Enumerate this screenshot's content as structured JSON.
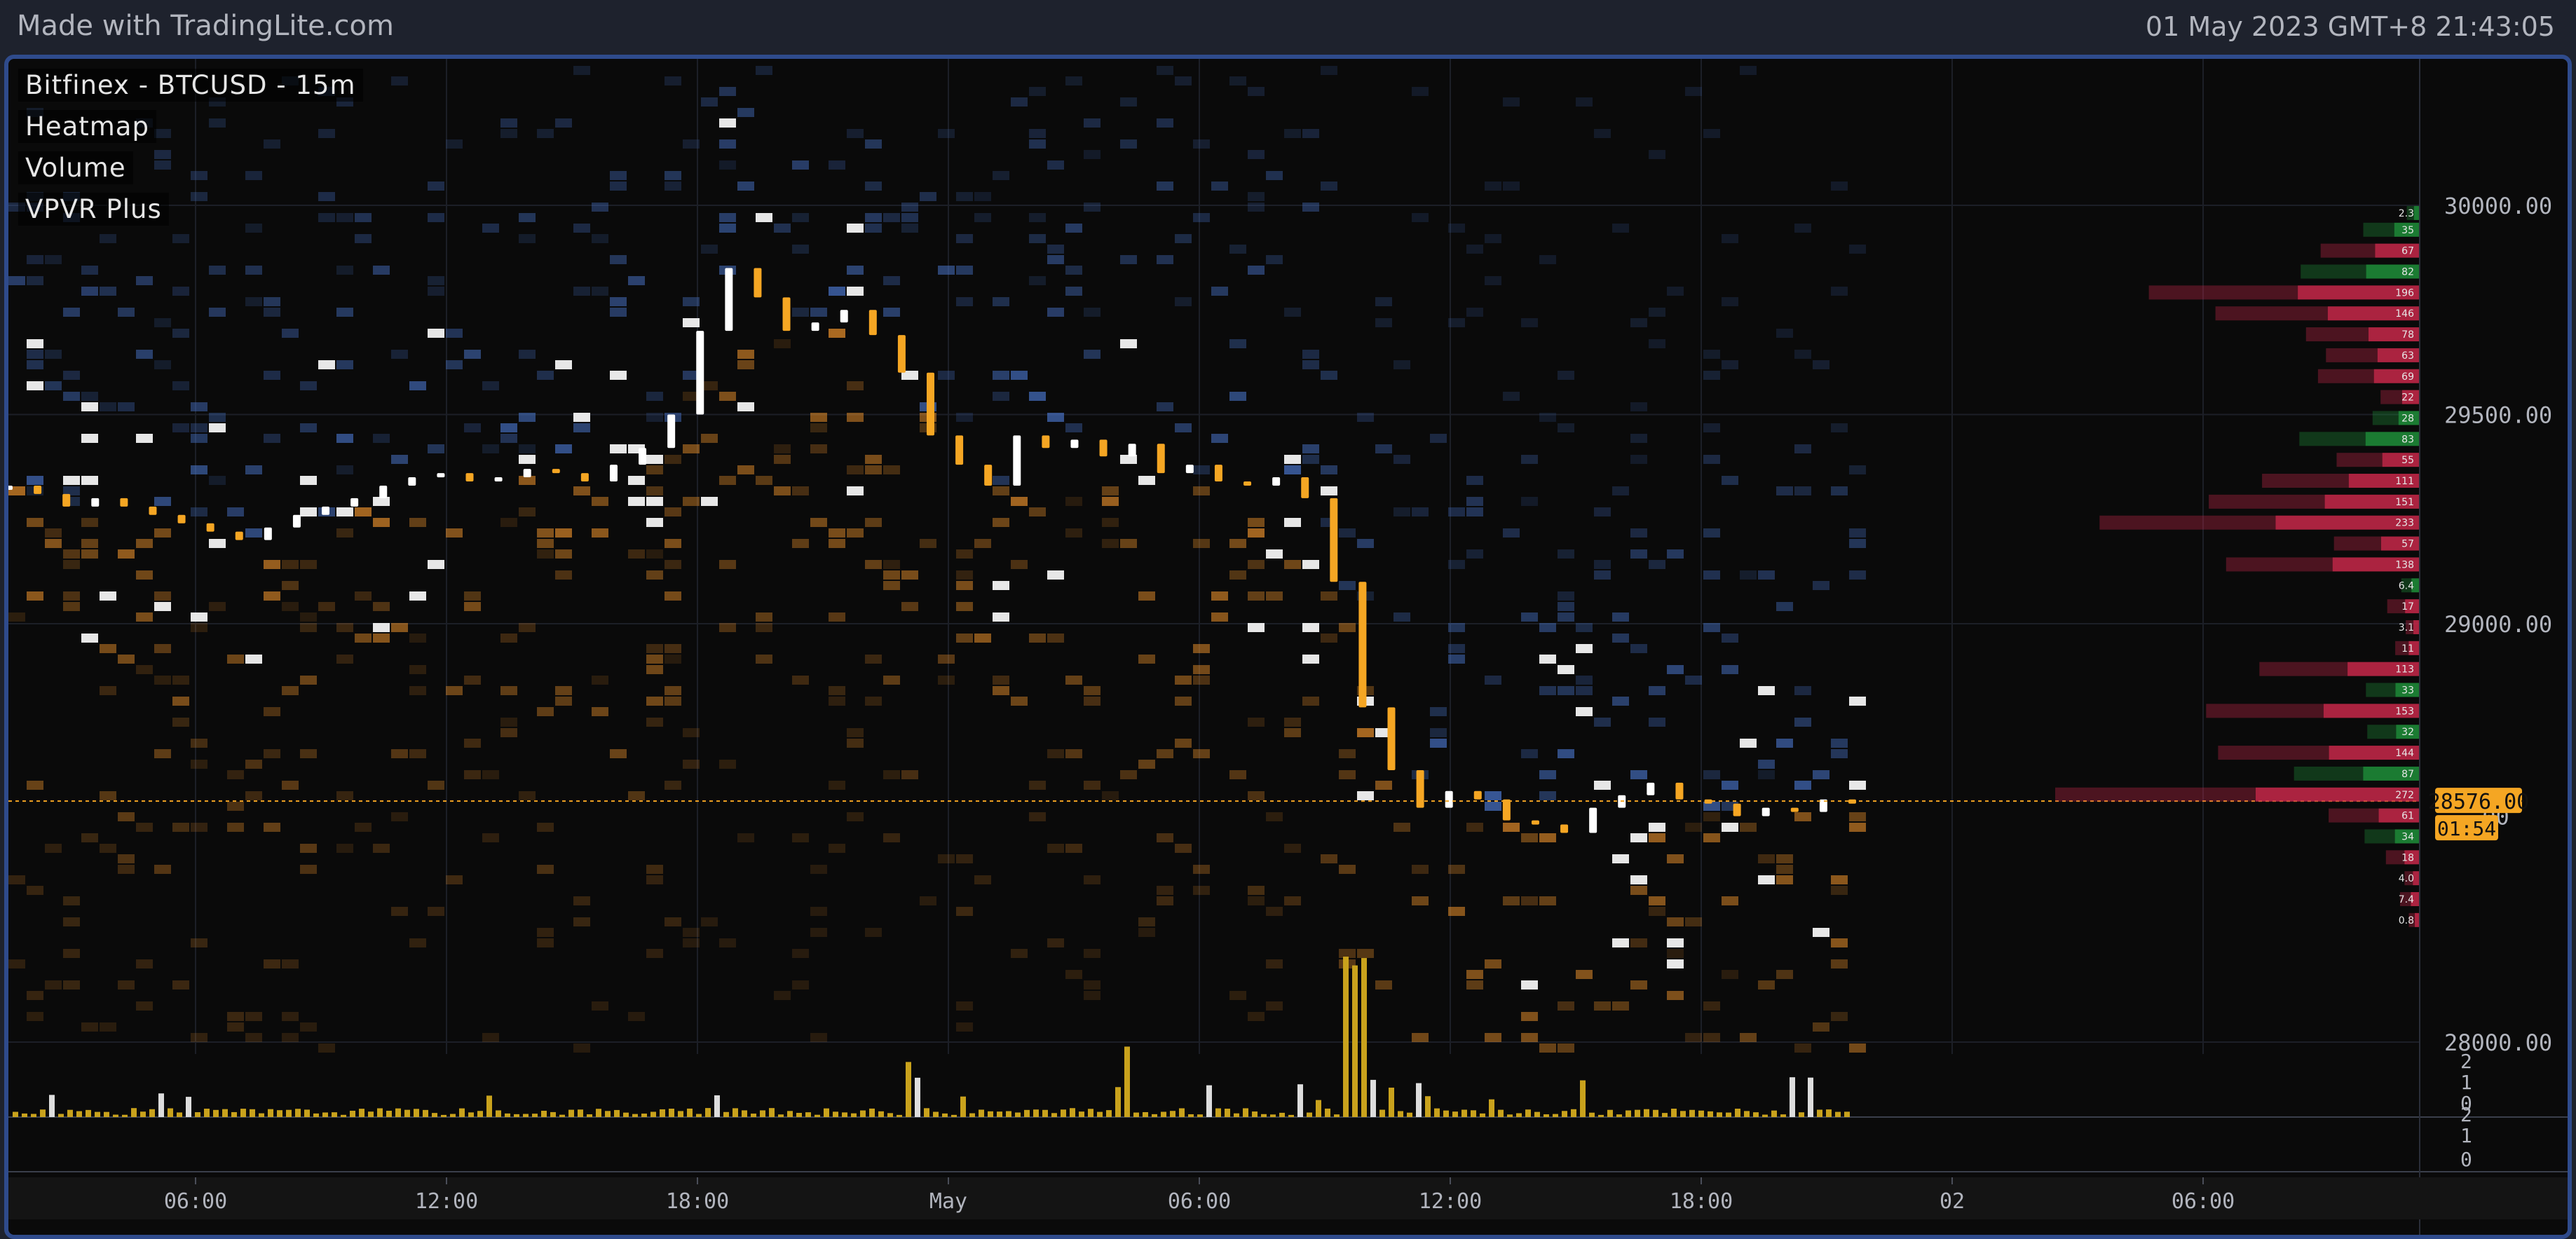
{
  "header": {
    "brand": "Made with TradingLite.com",
    "timestamp": "01 May 2023 GMT+8 21:43:05"
  },
  "overlay": {
    "symbol": "Bitfinex - BTCUSD - 15m",
    "indicators": [
      "Heatmap",
      "Volume",
      "VPVR Plus"
    ]
  },
  "colors": {
    "frame_border": "#2f4b8c",
    "background": "#0a0a0a",
    "bid_heat": "#ff9d2e",
    "ask_heat": "#4d7bd6",
    "wall": "#ffffff",
    "candle": "#f5a623",
    "volume": "#c9a21c",
    "vpvr_sell": "#c8284a",
    "vpvr_buy": "#1f8f3a",
    "price_tag": "#f5a623"
  },
  "chart_data": {
    "type": "heatmap",
    "title": "Bitfinex - BTCUSD - 15m",
    "price_axis": {
      "ticks": [
        "30000.00",
        "29500.00",
        "29000.00",
        "28000.00"
      ],
      "tick_values": [
        30000,
        29500,
        29000,
        28000
      ],
      "partial_tick": ".00"
    },
    "time_axis": {
      "labels": [
        "06:00",
        "12:00",
        "18:00",
        "May",
        "06:00",
        "12:00",
        "18:00",
        "02",
        "06:00"
      ]
    },
    "last_price": {
      "value": "28576.00",
      "countdown": "01:54"
    },
    "volume_axis": {
      "upper": [
        "2",
        "1",
        "0"
      ],
      "lower": [
        "2",
        "1",
        "0"
      ]
    },
    "vpvr": {
      "prices": [
        29980,
        29940,
        29890,
        29840,
        29790,
        29740,
        29690,
        29640,
        29590,
        29540,
        29490,
        29440,
        29390,
        29340,
        29290,
        29240,
        29190,
        29140,
        29090,
        29040,
        28990,
        28940,
        28890,
        28840,
        28790,
        28740,
        28690,
        28640,
        28590,
        28540,
        28490,
        28440,
        28390,
        28340
      ],
      "labels": [
        "2.3",
        "35",
        "67",
        "82",
        "196",
        "146",
        "78",
        "63",
        "69",
        "22",
        "28",
        "83",
        "55",
        "111",
        "151",
        "233",
        "57",
        "138",
        "6.4",
        "17",
        "3.1",
        "11",
        "113",
        "33",
        "153",
        "32",
        "144",
        "87",
        "272",
        "61",
        "34",
        "18",
        "4.0",
        "7.4",
        "0.8"
      ],
      "sides": [
        "b",
        "b",
        "s",
        "b",
        "s",
        "s",
        "s",
        "s",
        "s",
        "s",
        "b",
        "b",
        "s",
        "s",
        "s",
        "s",
        "s",
        "s",
        "b",
        "s",
        "s",
        "s",
        "s",
        "b",
        "s",
        "b",
        "s",
        "b",
        "s",
        "s",
        "b",
        "s",
        "s",
        "s",
        "s"
      ]
    },
    "price_path": [
      29330,
      29310,
      29280,
      29300,
      29280,
      29260,
      29240,
      29220,
      29200,
      29230,
      29260,
      29280,
      29300,
      29330,
      29350,
      29360,
      29340,
      29350,
      29370,
      29360,
      29340,
      29380,
      29420,
      29500,
      29700,
      29850,
      29780,
      29700,
      29720,
      29750,
      29690,
      29600,
      29450,
      29380,
      29330,
      29450,
      29420,
      29440,
      29400,
      29430,
      29360,
      29380,
      29340,
      29330,
      29350,
      29300,
      29100,
      28800,
      28650,
      28560,
      28600,
      28580,
      28530,
      28520,
      28500,
      28560,
      28590,
      28620,
      28580,
      28570,
      28540,
      28560,
      28550,
      28580,
      28576
    ]
  }
}
